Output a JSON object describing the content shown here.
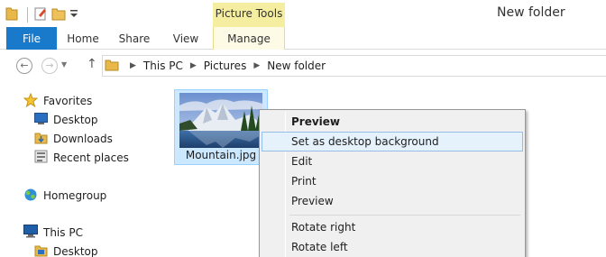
{
  "window": {
    "title": "New folder",
    "context_tab_group": "Picture Tools"
  },
  "quick_access": {
    "icons": [
      "folder-icon",
      "properties-icon",
      "new-folder-icon",
      "customize-dropdown-icon"
    ]
  },
  "ribbon": {
    "tabs": [
      {
        "label": "File"
      },
      {
        "label": "Home"
      },
      {
        "label": "Share"
      },
      {
        "label": "View"
      },
      {
        "label": "Manage"
      }
    ]
  },
  "address": {
    "crumbs": [
      "This PC",
      "Pictures",
      "New folder"
    ]
  },
  "nav_pane": {
    "items": [
      {
        "label": "Favorites",
        "icon": "star-icon"
      },
      {
        "label": "Desktop",
        "icon": "desktop-icon"
      },
      {
        "label": "Downloads",
        "icon": "downloads-icon"
      },
      {
        "label": "Recent places",
        "icon": "recent-places-icon"
      },
      {
        "label": "Homegroup",
        "icon": "homegroup-icon"
      },
      {
        "label": "This PC",
        "icon": "computer-icon"
      },
      {
        "label": "Desktop",
        "icon": "desktop-folder-icon"
      }
    ]
  },
  "content": {
    "files": [
      {
        "name": "Mountain.jpg",
        "selected": true
      }
    ]
  },
  "context_menu": {
    "items": [
      {
        "label": "Preview",
        "bold": true
      },
      {
        "label": "Set as desktop background",
        "hot": true
      },
      {
        "label": "Edit"
      },
      {
        "label": "Print"
      },
      {
        "label": "Preview"
      },
      {
        "label": "Rotate right"
      },
      {
        "label": "Rotate left"
      }
    ]
  },
  "colors": {
    "file_tab": "#1979ca",
    "context_tab": "#f5eea1",
    "selection": "#cce8ff",
    "menu_hover": "#e5f1fb"
  }
}
